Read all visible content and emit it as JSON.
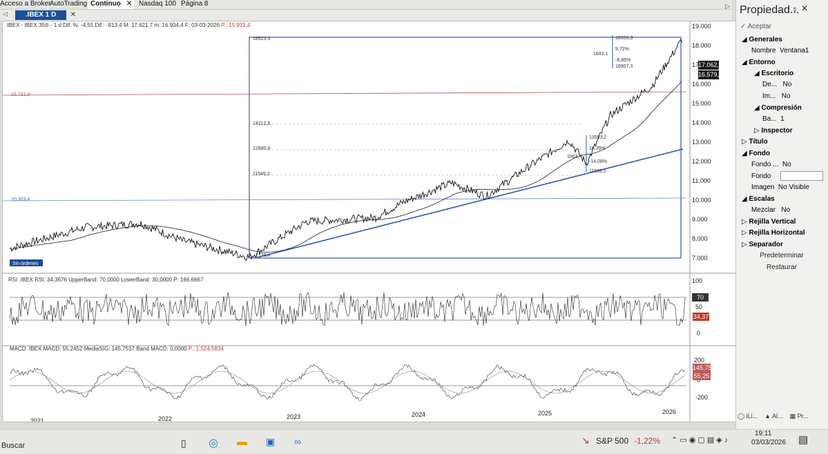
{
  "top_tabs": [
    "Acceso a Broker",
    "AutoTrading",
    "Continuo",
    "Nasdaq 100",
    "Página 8"
  ],
  "chart_tab": {
    "label": ".IBEX 1 D"
  },
  "legend": {
    "main": ".IBEX - IBEX 35® -  1 d Dif. %: -4,55 Dif.: -813,4 M: 17.621,7 m: 16.904,4 F: 03-03-2026",
    "main_p": "P.: 15.921,4",
    "rsi": "RSI .IBEX RSI: 34,3676 UpperBand: 70,0000 LowerBand: 30,0000 P: 166,6667",
    "macd_a": "MACD .IBEX MACD: 55,2452 MediaSIG: 145,7517 Band MACD: 0,0000",
    "macd_p": "P.: 1.524,5834"
  },
  "price_axis": [
    "19.000",
    "18.000",
    "17.000",
    "16.000",
    "15.000",
    "14.000",
    "13.000",
    "12.000",
    "11.000",
    "10.000",
    "9.000",
    "8.000",
    "7.000"
  ],
  "price_boxes": {
    "last": "17.062,4",
    "ma": "16.579,8"
  },
  "level_labels": {
    "hline_15721": "15.721,0",
    "hline_10303": "10.303,4",
    "box_top": "18523,3",
    "box_bottom": "7138,4",
    "fib_a": "14212,5",
    "fib_b": "12880,8",
    "fib_c": "11549,2",
    "sin_ordenes": "Sin órdenes"
  },
  "measure_top": {
    "hi": "18550,3",
    "range": "1643,1",
    "pct_up": "9,72%",
    "pct_down": "-8,86%",
    "lo": "16907,3"
  },
  "measure_mid": {
    "hi": "13503,2",
    "range": "1903,7",
    "pct_up": "16,39%",
    "pct_down": "-14,08%",
    "lo": "11699,5"
  },
  "rsi_axis": [
    "100",
    "50",
    "0"
  ],
  "rsi_boxes": {
    "upper": "70",
    "value": "34,37"
  },
  "macd_axis": [
    "200",
    "0",
    "-200"
  ],
  "macd_boxes": {
    "sig": "145,75",
    "macd": "55,25"
  },
  "time_axis": [
    "2021",
    "2022",
    "2023",
    "2024",
    "2025",
    "2026"
  ],
  "right_panel": {
    "title": "Propiedad...",
    "accept": "Aceptar",
    "sections": {
      "generales": "Generales",
      "nombre_label": "Nombre",
      "nombre_value": "Ventana1",
      "entorno": "Entorno",
      "escritorio": "Escritorio",
      "de_label": "De...",
      "de_value": "No",
      "im_label": "Im...",
      "im_value": "No",
      "compresion": "Compresión",
      "ba_label": "Ba...",
      "ba_value": "1",
      "inspector": "Inspector",
      "titulo": "Título",
      "fondo": "Fondo",
      "fondo_dots_label": "Fondo ...",
      "fondo_dots_value": "No",
      "fondo_label": "Fondo",
      "imagen_label": "Imagen",
      "imagen_value": "No Visible",
      "escalas": "Escalas",
      "mezclar_label": "Mezclar",
      "mezclar_value": "No",
      "rejilla_v": "Rejilla Vertical",
      "rejilla_h": "Rejilla Horizontal",
      "separador": "Separador"
    },
    "predeterminar": "Predeterminar",
    "restaurar": "Restaurar",
    "bottom_tabs": [
      "iLi...",
      "Al...",
      "Pr..."
    ]
  },
  "taskbar": {
    "search": "Buscar",
    "ticker": "S&P 500",
    "ticker_change": "-1,22%",
    "time": "19:11",
    "date": "03/03/2026"
  },
  "colors": {
    "accent": "#1b4f9a",
    "price_red": "#c0392b",
    "line_blue": "#2a55b8"
  }
}
